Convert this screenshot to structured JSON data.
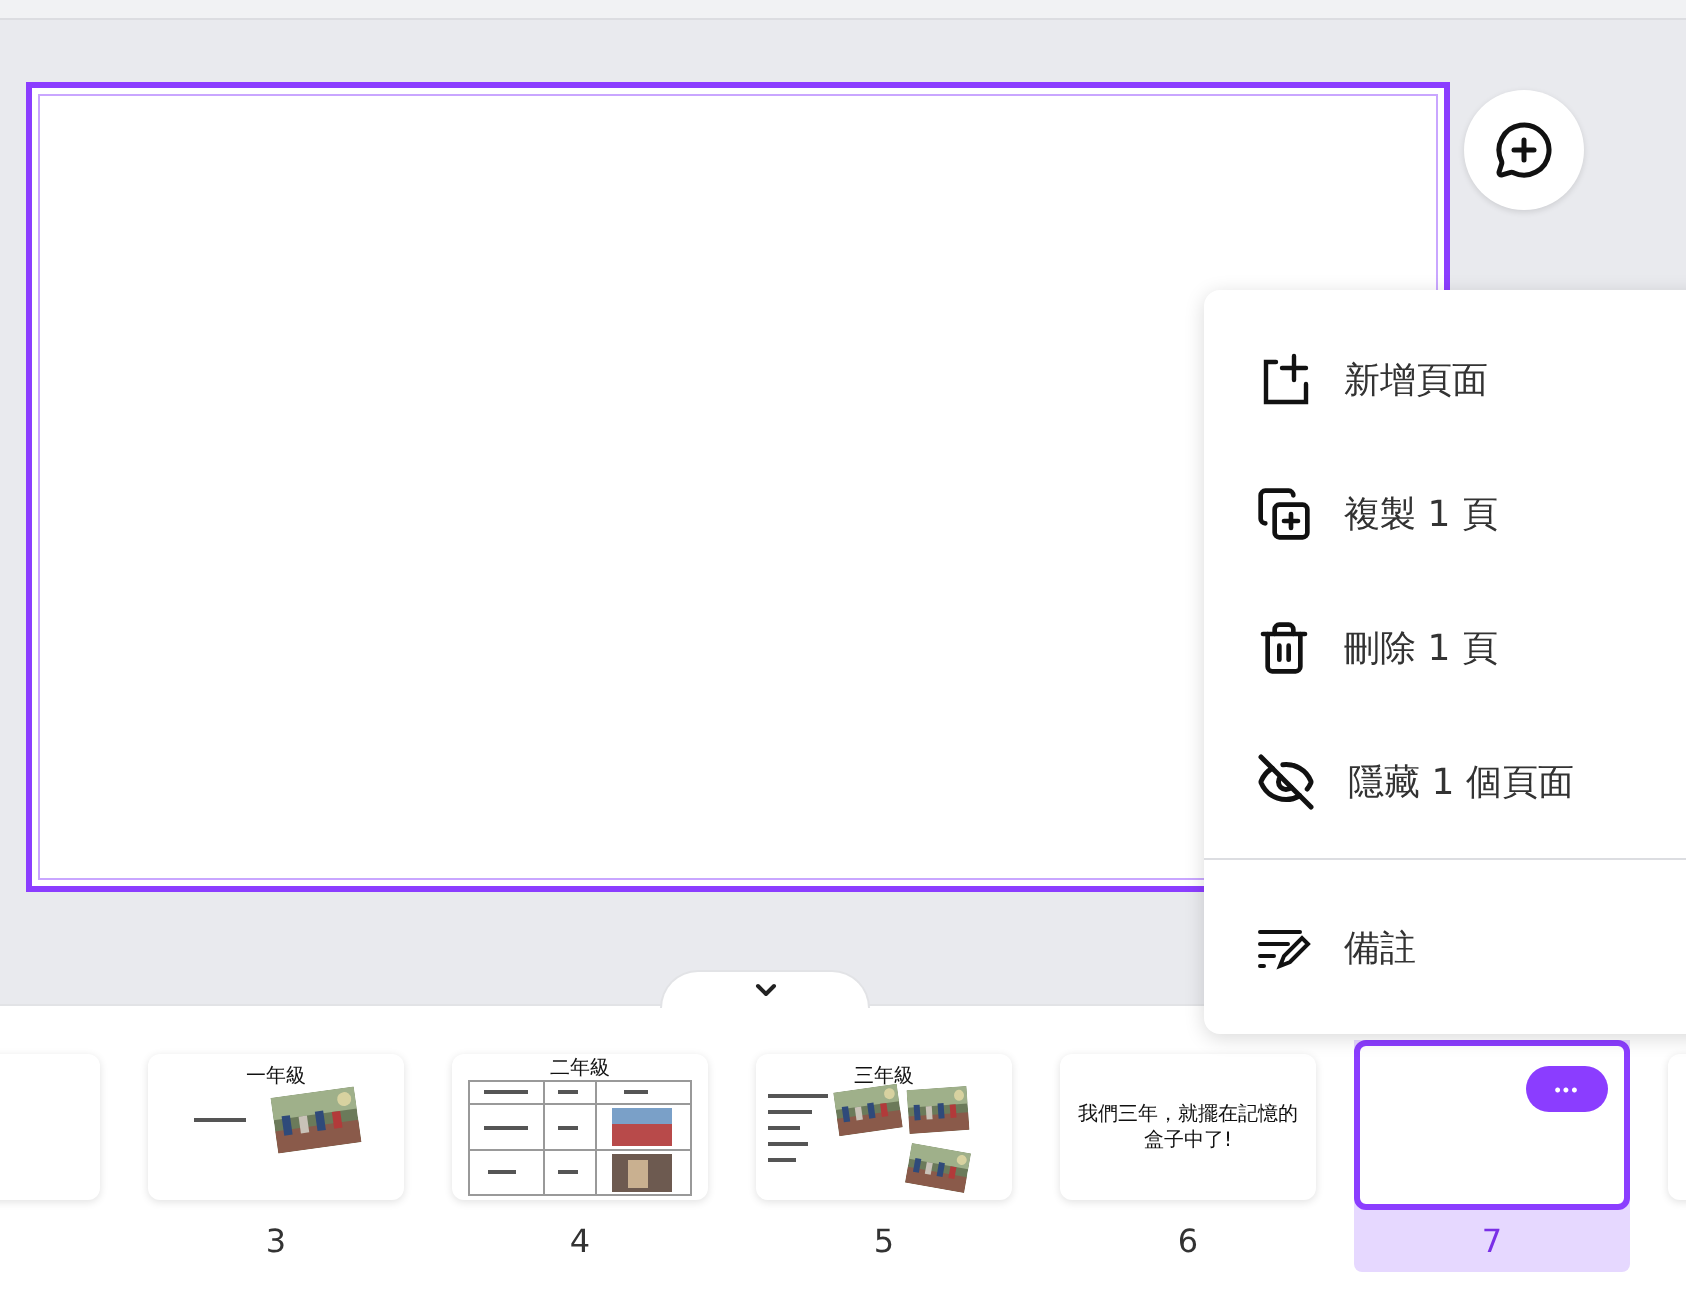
{
  "canvas": {
    "slide_selected": true
  },
  "context_menu": {
    "items": [
      {
        "kind": "add",
        "label": "新增頁面"
      },
      {
        "kind": "copy",
        "label": "複製 1 頁"
      },
      {
        "kind": "delete",
        "label": "刪除 1 頁"
      },
      {
        "kind": "hide",
        "label": "隱藏 1 個頁面"
      },
      {
        "kind": "notes",
        "label": "備註",
        "divider_before": true
      }
    ]
  },
  "thumbnails": [
    {
      "kind": "blank",
      "selected": false
    },
    {
      "kind": "title-photo",
      "title": "一年級",
      "number": "3",
      "selected": false
    },
    {
      "kind": "table",
      "title": "二年級",
      "number": "4",
      "selected": false
    },
    {
      "kind": "bullets",
      "title": "三年級",
      "number": "5",
      "selected": false
    },
    {
      "kind": "text",
      "text": "我們三年，就擺在記憶的盒子中了!",
      "number": "6",
      "selected": false
    },
    {
      "kind": "blank",
      "number": "7",
      "selected": true,
      "more_button": "•••"
    },
    {
      "kind": "blank",
      "selected": false
    }
  ]
}
